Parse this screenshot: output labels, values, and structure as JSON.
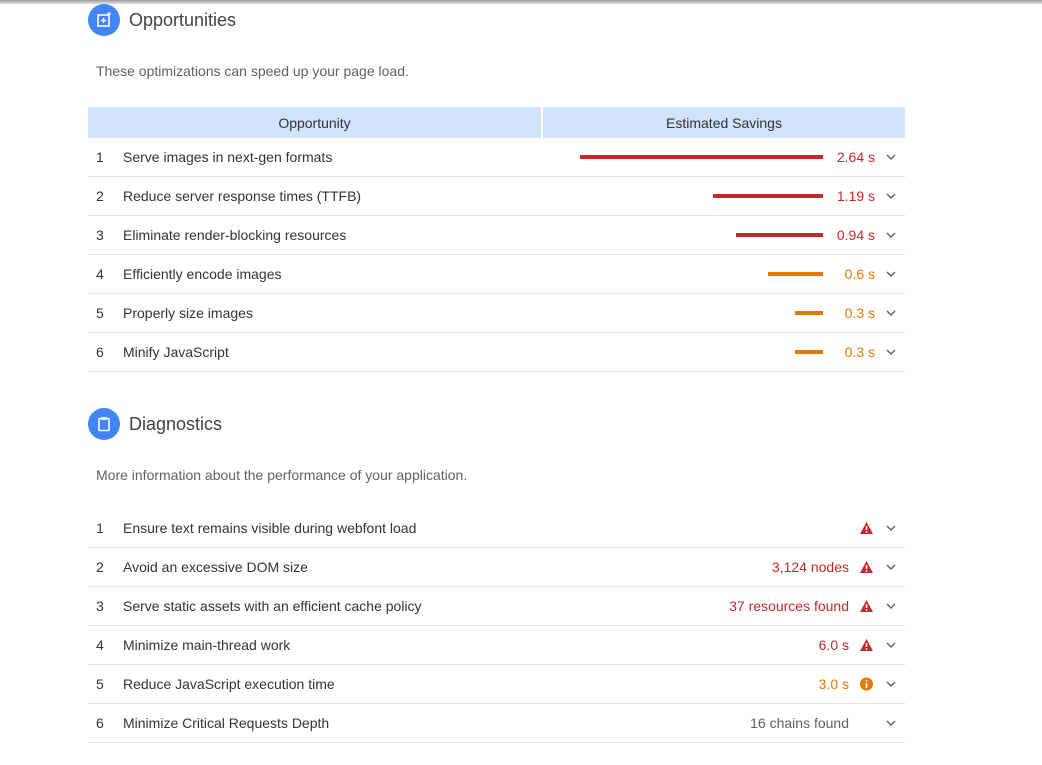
{
  "colors": {
    "fail": "#c62828",
    "average": "#e67700",
    "accent": "#4285f4",
    "header_bg": "#d2e3fc"
  },
  "opportunities": {
    "title": "Opportunities",
    "description": "These optimizations can speed up your page load.",
    "col_opportunity": "Opportunity",
    "col_savings": "Estimated Savings",
    "max_savings_s": 2.64,
    "rows": [
      {
        "n": "1",
        "label": "Serve images in next-gen formats",
        "savings_s": 2.64,
        "value": "2.64 s",
        "severity": "fail"
      },
      {
        "n": "2",
        "label": "Reduce server response times (TTFB)",
        "savings_s": 1.19,
        "value": "1.19 s",
        "severity": "fail"
      },
      {
        "n": "3",
        "label": "Eliminate render-blocking resources",
        "savings_s": 0.94,
        "value": "0.94 s",
        "severity": "fail"
      },
      {
        "n": "4",
        "label": "Efficiently encode images",
        "savings_s": 0.6,
        "value": "0.6 s",
        "severity": "average"
      },
      {
        "n": "5",
        "label": "Properly size images",
        "savings_s": 0.3,
        "value": "0.3 s",
        "severity": "average"
      },
      {
        "n": "6",
        "label": "Minify JavaScript",
        "savings_s": 0.3,
        "value": "0.3 s",
        "severity": "average"
      }
    ]
  },
  "diagnostics": {
    "title": "Diagnostics",
    "description": "More information about the performance of your application.",
    "rows": [
      {
        "n": "1",
        "label": "Ensure text remains visible during webfont load",
        "value": "",
        "icon": "warning-icon",
        "severity": "fail"
      },
      {
        "n": "2",
        "label": "Avoid an excessive DOM size",
        "value": "3,124 nodes",
        "icon": "warning-icon",
        "severity": "fail"
      },
      {
        "n": "3",
        "label": "Serve static assets with an efficient cache policy",
        "value": "37 resources found",
        "icon": "warning-icon",
        "severity": "fail"
      },
      {
        "n": "4",
        "label": "Minimize main-thread work",
        "value": "6.0 s",
        "icon": "warning-icon",
        "severity": "fail"
      },
      {
        "n": "5",
        "label": "Reduce JavaScript execution time",
        "value": "3.0 s",
        "icon": "info-icon",
        "severity": "average"
      },
      {
        "n": "6",
        "label": "Minimize Critical Requests Depth",
        "value": "16 chains found",
        "icon": "",
        "severity": "pass"
      }
    ]
  }
}
